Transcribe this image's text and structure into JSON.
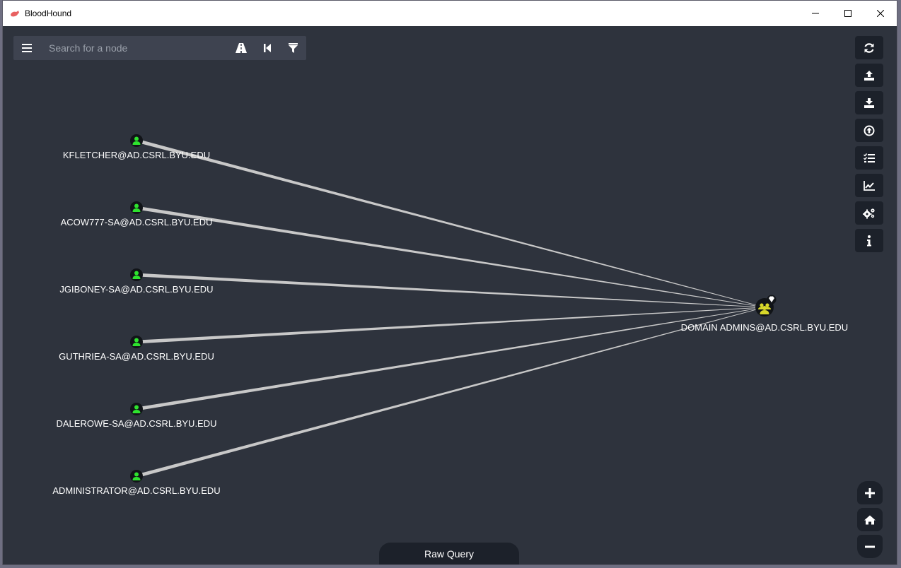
{
  "window": {
    "title": "BloodHound"
  },
  "search": {
    "placeholder": "Search for a node"
  },
  "graph": {
    "user_nodes": [
      {
        "label": "KFLETCHER@AD.CSRL.BYU.EDU",
        "icon": "user-icon"
      },
      {
        "label": "ACOW777-SA@AD.CSRL.BYU.EDU",
        "icon": "user-icon"
      },
      {
        "label": "JGIBONEY-SA@AD.CSRL.BYU.EDU",
        "icon": "user-icon"
      },
      {
        "label": "GUTHRIEA-SA@AD.CSRL.BYU.EDU",
        "icon": "user-icon"
      },
      {
        "label": "DALEROWE-SA@AD.CSRL.BYU.EDU",
        "icon": "user-icon"
      },
      {
        "label": "ADMINISTRATOR@AD.CSRL.BYU.EDU",
        "icon": "user-icon"
      }
    ],
    "group_node": {
      "label": "DOMAIN ADMINS@AD.CSRL.BYU.EDU",
      "icon": "group-icon",
      "badge": "high-value-gem-icon"
    }
  },
  "right_toolbar": [
    "refresh-icon",
    "upload-icon",
    "download-icon",
    "import-icon",
    "query-list-icon",
    "chart-icon",
    "settings-icon",
    "info-icon"
  ],
  "zoom_controls": [
    "plus-icon",
    "home-icon",
    "minus-icon"
  ],
  "raw_query": {
    "label": "Raw Query"
  },
  "colors": {
    "background": "#2e333d",
    "user_node": "#2ee32e",
    "group_node": "#d8d82a",
    "edge": "#c8c8c8"
  }
}
